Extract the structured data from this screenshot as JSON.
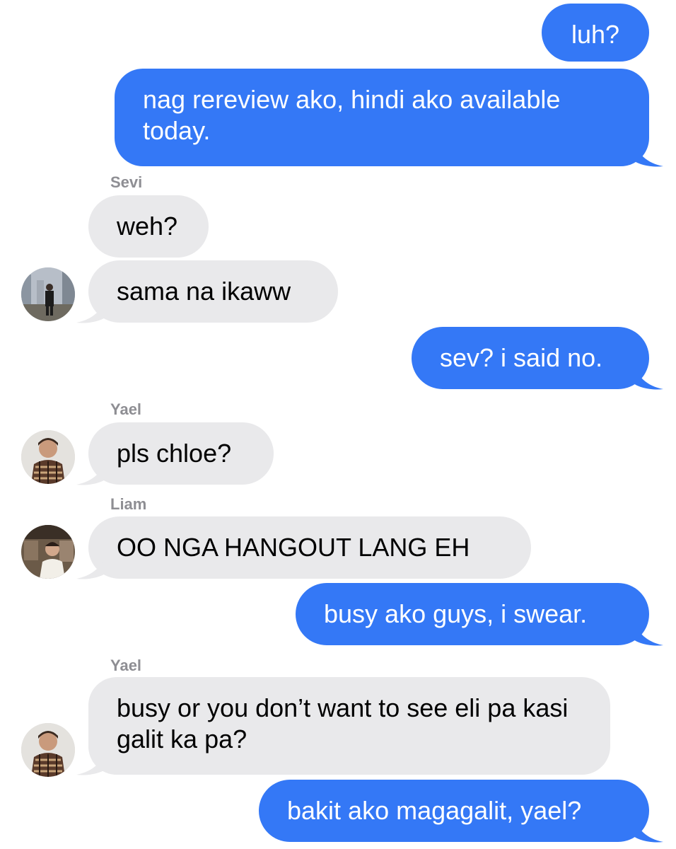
{
  "messages": [
    {
      "text": "luh?"
    },
    {
      "text": "nag rereview ako, hindi ako available today."
    },
    {
      "sender": "Sevi",
      "text": "weh?"
    },
    {
      "text": "sama na ikaww"
    },
    {
      "text": "sev? i said no."
    },
    {
      "sender": "Yael",
      "text": "pls chloe?"
    },
    {
      "sender": "Liam",
      "text": "OO NGA HANGOUT LANG EH"
    },
    {
      "text": "busy ako guys, i swear."
    },
    {
      "sender": "Yael",
      "text": "busy or you don’t want to see eli pa kasi galit ka pa?"
    },
    {
      "text": "bakit ako magagalit, yael?"
    }
  ],
  "colors": {
    "sent_bubble": "#3478f6",
    "received_bubble": "#e9e9eb",
    "sender_name": "#8e8e93"
  }
}
